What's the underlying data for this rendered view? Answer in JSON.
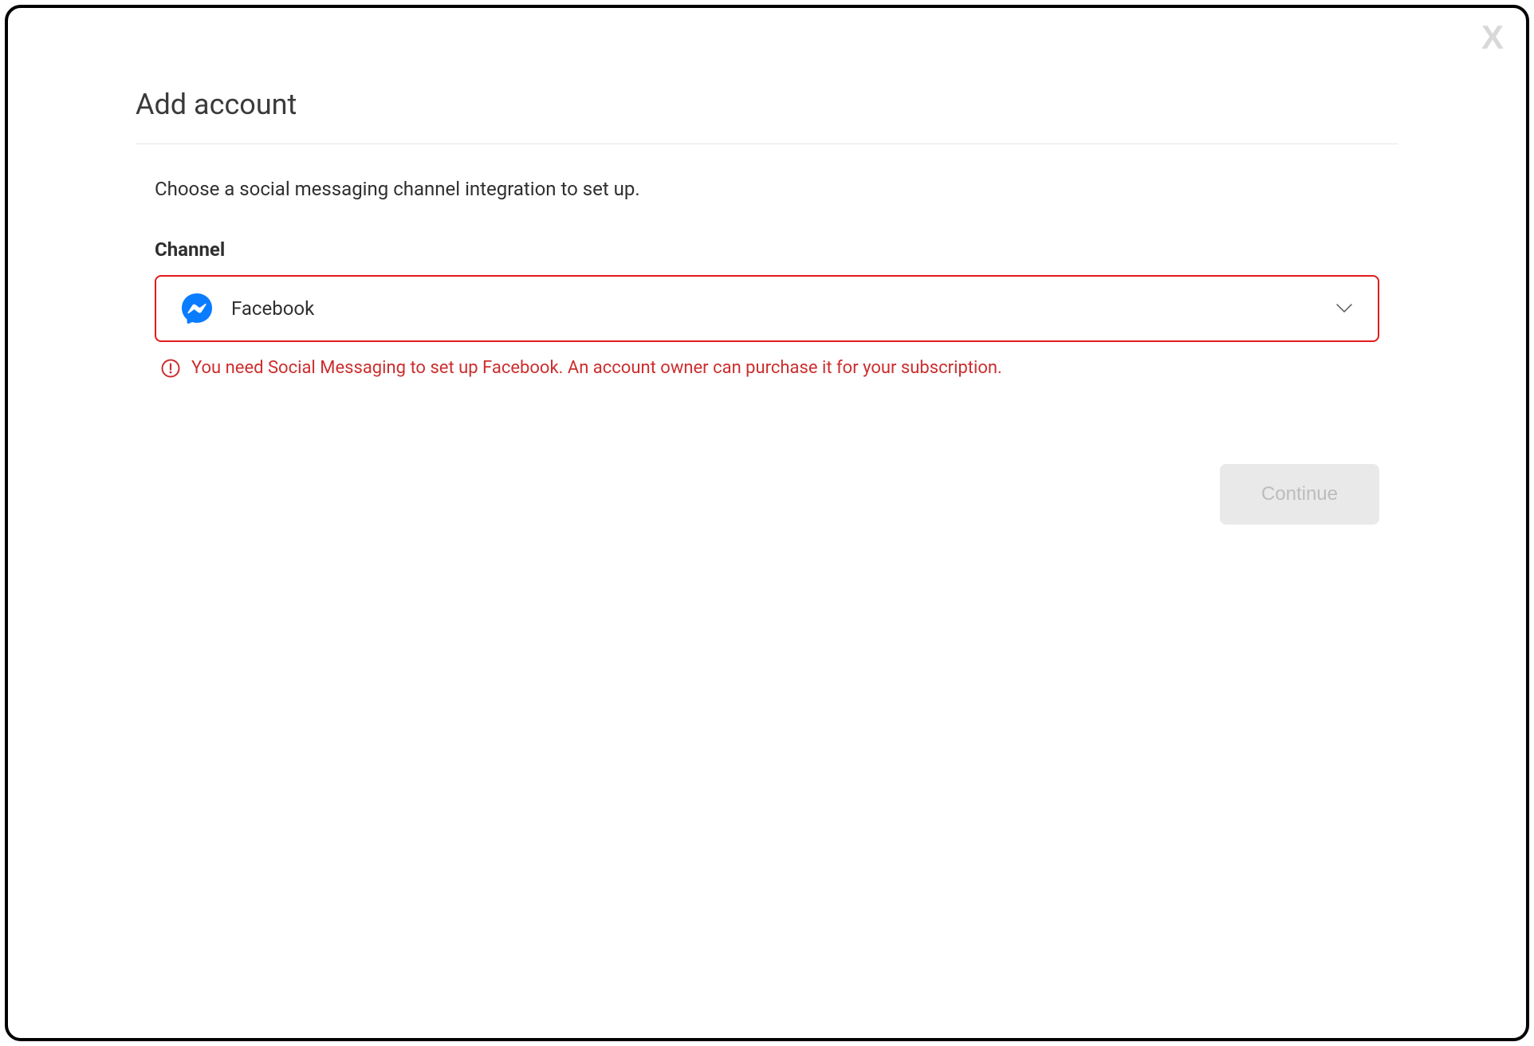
{
  "modal": {
    "title": "Add account",
    "description": "Choose a social messaging channel integration to set up.",
    "close_label": "X"
  },
  "channel_field": {
    "label": "Channel",
    "selected": "Facebook",
    "error": "You need Social Messaging to set up Facebook. An account owner can purchase it for your subscription."
  },
  "actions": {
    "continue_label": "Continue"
  },
  "colors": {
    "error": "#cc2e2e",
    "error_border": "#e31b1b",
    "messenger_blue": "#0a7cff"
  }
}
